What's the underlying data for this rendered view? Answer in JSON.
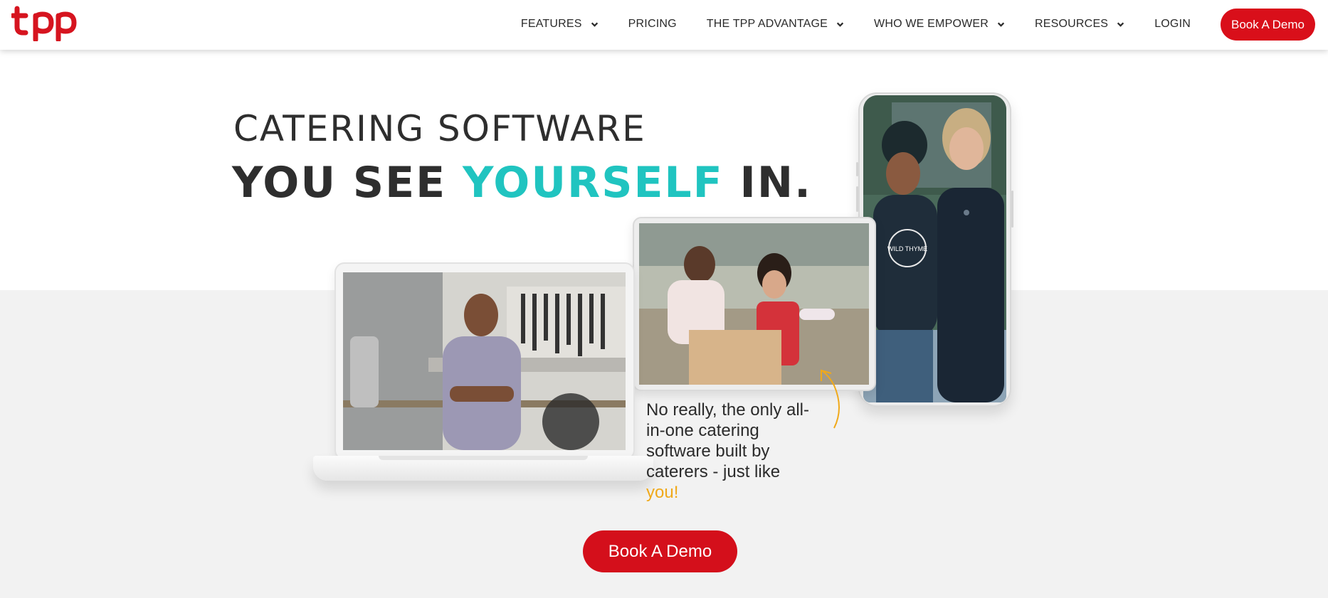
{
  "header": {
    "logo_text": "tpp",
    "nav": [
      {
        "label": "FEATURES",
        "has_dropdown": true
      },
      {
        "label": "PRICING",
        "has_dropdown": false
      },
      {
        "label": "THE TPP ADVANTAGE",
        "has_dropdown": true
      },
      {
        "label": "WHO WE EMPOWER",
        "has_dropdown": true
      },
      {
        "label": "RESOURCES",
        "has_dropdown": true
      },
      {
        "label": "LOGIN",
        "has_dropdown": false
      }
    ],
    "cta_label": "Book A Demo"
  },
  "hero": {
    "headline_line1": "CATERING SOFTWARE",
    "headline_line2_before": "YOU SEE ",
    "headline_line2_accent": "YOURSELF",
    "headline_line2_after": " IN.",
    "tagline_main": "No really, the only all-in-one catering software built by caterers - just like ",
    "tagline_highlight": "you!",
    "phone_shirt_text": "WILD THYME",
    "cta_label": "Book A Demo"
  },
  "colors": {
    "brand_red": "#d90f1a",
    "accent_teal": "#20c4c0",
    "highlight_yellow": "#f0a91a"
  },
  "icons": [
    "tpp-logo",
    "chevron-down-icon",
    "curved-arrow-icon"
  ]
}
